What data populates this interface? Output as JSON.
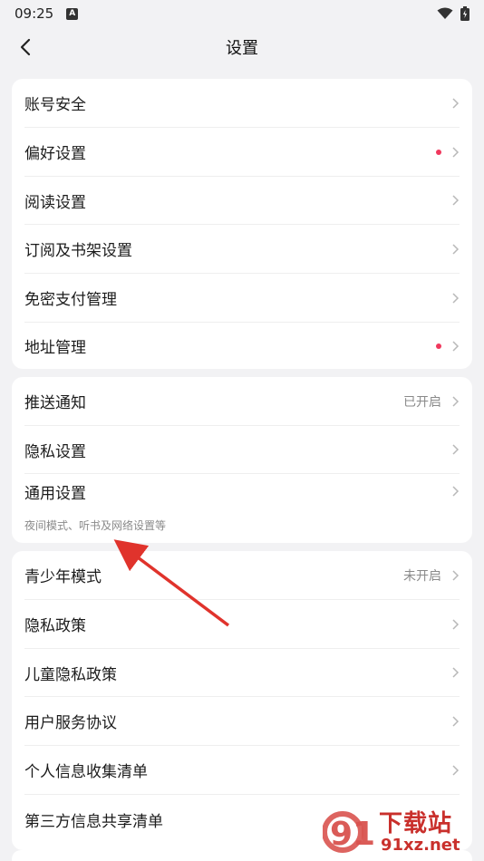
{
  "status": {
    "time": "09:25",
    "badge": "A"
  },
  "nav": {
    "title": "设置"
  },
  "group1": [
    {
      "label": "账号安全"
    },
    {
      "label": "偏好设置",
      "dot": true
    },
    {
      "label": "阅读设置"
    },
    {
      "label": "订阅及书架设置"
    },
    {
      "label": "免密支付管理"
    },
    {
      "label": "地址管理",
      "dot": true
    }
  ],
  "group2": [
    {
      "label": "推送通知",
      "value": "已开启"
    },
    {
      "label": "隐私设置"
    },
    {
      "label": "通用设置",
      "sub": "夜间模式、听书及网络设置等"
    }
  ],
  "group3": [
    {
      "label": "青少年模式",
      "value": "未开启"
    },
    {
      "label": "隐私政策"
    },
    {
      "label": "儿童隐私政策"
    },
    {
      "label": "用户服务协议"
    },
    {
      "label": "个人信息收集清单"
    },
    {
      "label": "第三方信息共享清单"
    }
  ],
  "watermark": {
    "text1": "下载站",
    "text2": "91xz.net"
  },
  "colors": {
    "dot": "#f0385d",
    "arrow": "#e0332c",
    "background": "#f2f2f4"
  }
}
